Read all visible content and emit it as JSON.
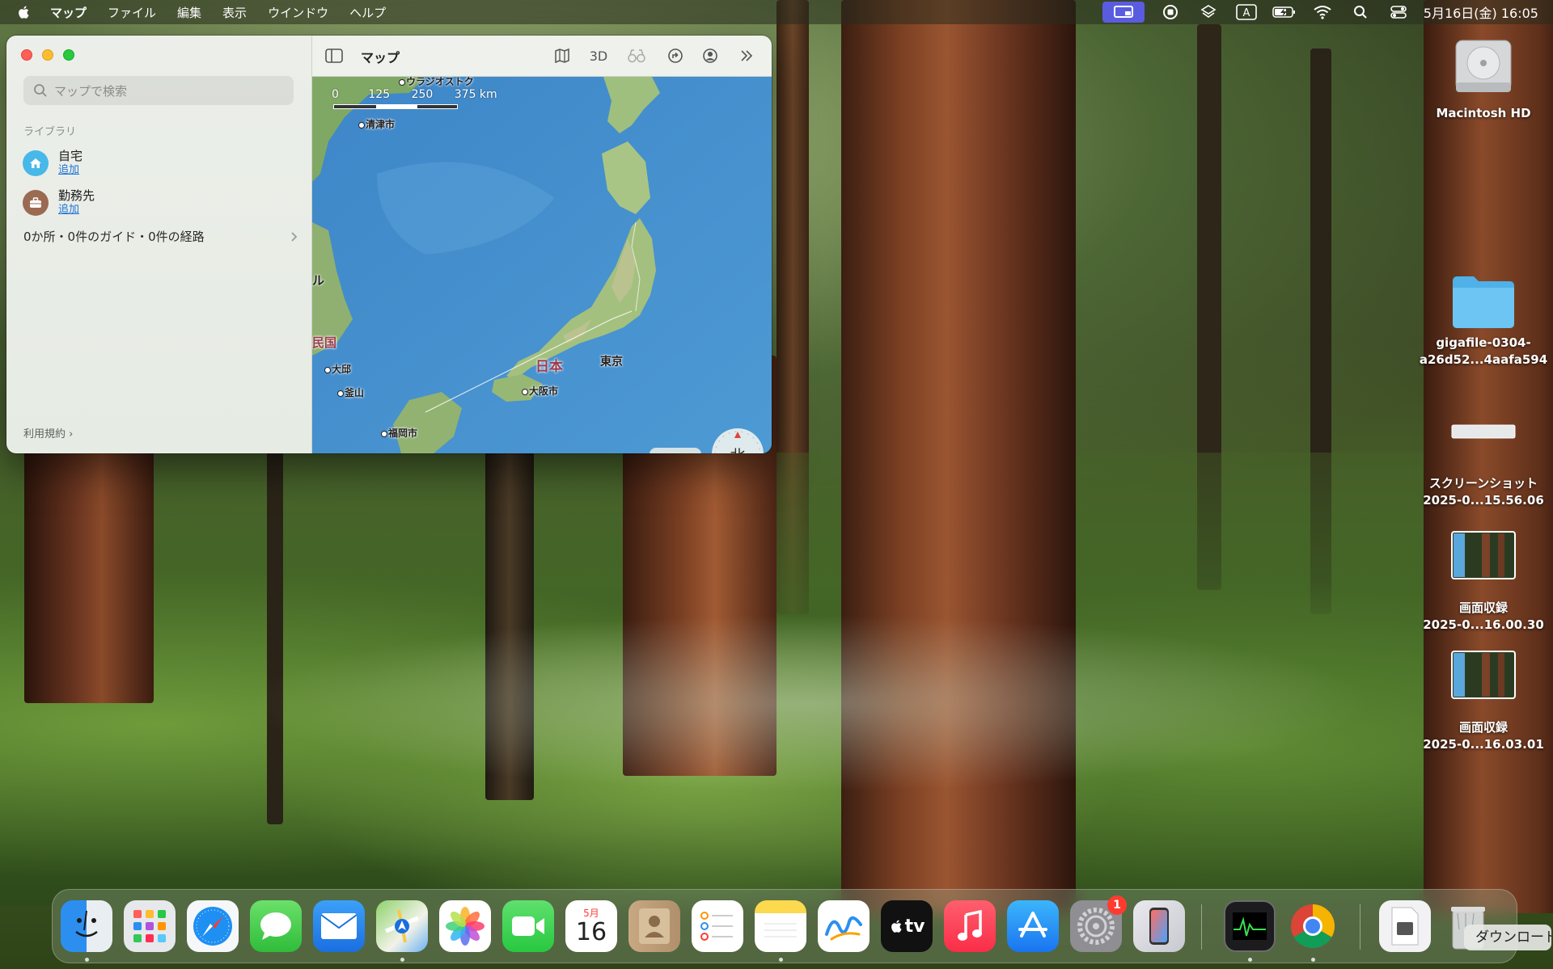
{
  "menubar": {
    "app_name": "マップ",
    "items": [
      "ファイル",
      "編集",
      "表示",
      "ウインドウ",
      "ヘルプ"
    ],
    "clock": "5月16日(金) 16:05"
  },
  "maps": {
    "sidebar": {
      "search_placeholder": "マップで検索",
      "library_label": "ライブラリ",
      "home_title": "自宅",
      "home_action": "追加",
      "work_title": "勤務先",
      "work_action": "追加",
      "guides_summary": "0か所・0件のガイド・0件の経路",
      "terms": "利用規約"
    },
    "toolbar": {
      "title": "マップ",
      "three_d": "3D"
    },
    "map": {
      "scale_labels": [
        "0",
        "125",
        "250",
        "375 km"
      ],
      "labels": {
        "vladivostok": "ウラジオストク",
        "chongjin": "清津市",
        "japan": "日本",
        "tokyo": "東京",
        "osaka": "大阪市",
        "fukuoka": "福岡市",
        "daegu": "大邱",
        "busan": "釜山",
        "korea_partial": "民国",
        "seoul_partial": "ル"
      },
      "compass": "北",
      "zoom_out": "−",
      "zoom_in": "+"
    }
  },
  "desktop": {
    "icons": [
      {
        "line1": "Macintosh HD",
        "line2": ""
      },
      {
        "line1": "gigafile-0304-",
        "line2": "a26d52...4aafa594"
      },
      {
        "line1": "スクリーンショット",
        "line2": "2025-0...15.56.06"
      },
      {
        "line1": "画面収録",
        "line2": "2025-0...16.00.30"
      },
      {
        "line1": "画面収録",
        "line2": "2025-0...16.03.01"
      }
    ]
  },
  "dock": {
    "calendar_month": "5月",
    "calendar_day": "16",
    "settings_badge": "1",
    "tv_label": "tv",
    "tooltip": "ダウンロード"
  }
}
